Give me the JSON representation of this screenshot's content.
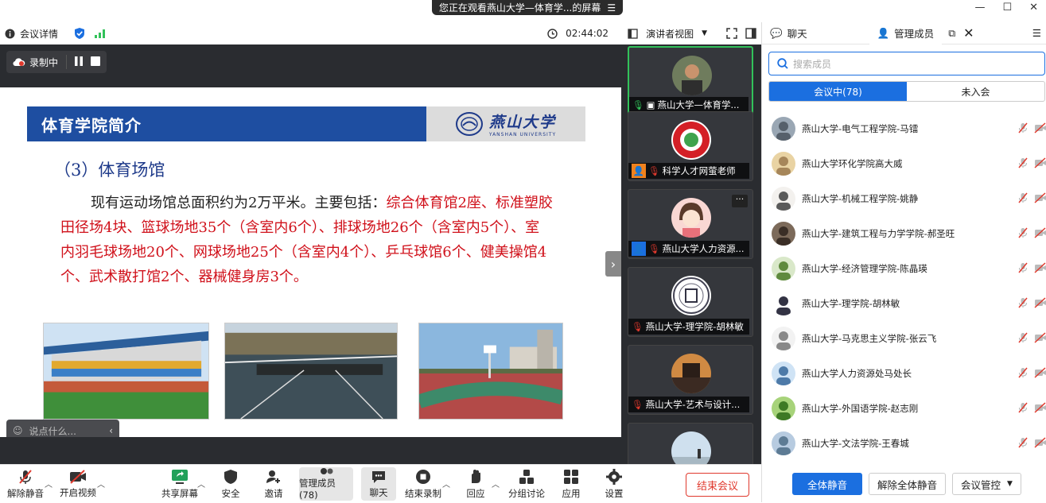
{
  "banner": {
    "text": "您正在观看燕山大学—体育学...的屏幕",
    "menu_icon": "menu-icon"
  },
  "window": {
    "min": "—",
    "max": "☐",
    "close": "✕"
  },
  "info_bar": {
    "meeting_details": "会议详情",
    "timer": "02:44:02",
    "view_mode": "演讲者视图"
  },
  "recording": {
    "label": "录制中"
  },
  "slide": {
    "header_title": "体育学院简介",
    "logo_text": "燕山大学",
    "logo_sub": "YANSHAN UNIVERSITY",
    "subtitle": "（3）体育场馆",
    "body_black": "现有运动场馆总面积约为2万平米。主要包括：",
    "body_red": "综合体育馆2座、标准塑胶田径场4块、篮球场地35个（含室内6个）、排球场地26个（含室内5个）、室内羽毛球场地20个、网球场地25个（含室内4个）、乒乓球馆6个、健美操馆4个、武术散打馆2个、器械健身房3个。"
  },
  "chat_input": {
    "placeholder": "说点什么..."
  },
  "video_tiles": [
    {
      "name": "燕山大学—体育学..."
    },
    {
      "name": "科学人才网萤老师"
    },
    {
      "name": "燕山大学人力资源..."
    },
    {
      "name": "燕山大学-理学院-胡林敏"
    },
    {
      "name": "燕山大学-艺术与设计..."
    }
  ],
  "right_panel": {
    "tab_chat": "聊天",
    "tab_members": "管理成员",
    "search_placeholder": "搜索成员",
    "seg_in": "会议中(78)",
    "seg_out": "未入会",
    "members": [
      "燕山大学-电气工程学院-马镭",
      "燕山大学环化学院高大威",
      "燕山大学-机械工程学院-姚静",
      "燕山大学-建筑工程与力学学院-郝圣旺",
      "燕山大学-经济管理学院-陈晶瑛",
      "燕山大学-理学院-胡林敏",
      "燕山大学-马克思主义学院-张云飞",
      "燕山大学人力资源处马处长",
      "燕山大学-外国语学院-赵志刚",
      "燕山大学-文法学院-王春城"
    ],
    "btn_mute_all": "全体静音",
    "btn_unmute_all": "解除全体静音",
    "btn_control": "会议管控"
  },
  "toolbar": {
    "unmute": "解除静音",
    "video": "开启视频",
    "share": "共享屏幕",
    "security": "安全",
    "invite": "邀请",
    "members": "管理成员(78)",
    "chat": "聊天",
    "end_record": "结束录制",
    "react": "回应",
    "breakout": "分组讨论",
    "apps": "应用",
    "settings": "设置",
    "end_meeting": "结束会议"
  },
  "colors": {
    "accent": "#1b6fe0",
    "danger": "#e0392d",
    "slide_red": "#d0101a",
    "slide_blue": "#1e4ea1"
  }
}
